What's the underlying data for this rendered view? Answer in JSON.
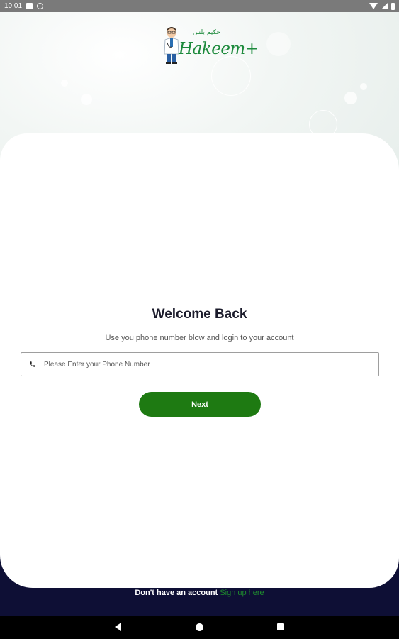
{
  "status_bar": {
    "time": "10:01",
    "icons": [
      "notification-box-icon",
      "do-not-disturb-icon",
      "wifi-icon",
      "signal-icon",
      "battery-icon"
    ]
  },
  "logo": {
    "title": "Hakeem+",
    "arabic": "حكيم بلس"
  },
  "login": {
    "title": "Welcome Back",
    "subtitle": "Use you phone number blow and login to your account",
    "phone_placeholder": "Please Enter your Phone Number",
    "next_label": "Next"
  },
  "footer": {
    "prompt": "Don't have an account",
    "signup_link": "Sign up here"
  },
  "colors": {
    "primary_green": "#1e7a12",
    "link_green": "#1e8a2e",
    "footer_navy": "#0e0f35"
  }
}
